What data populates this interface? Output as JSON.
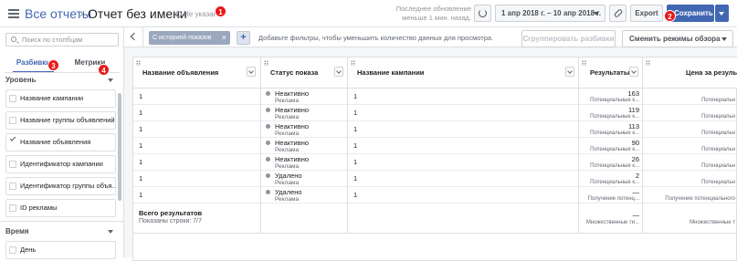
{
  "header": {
    "breadcrumb_root": "Все отчеты",
    "breadcrumb_sep": "›",
    "report_title": "Отчет без имени",
    "unnamed_label": "Не указан",
    "last_update": "Последнее обновление меньше 1 мин. назад.",
    "date_range": "1 апр 2018 г. – 10 апр 2018 г.",
    "export_label": "Export",
    "save_label": "Сохранить"
  },
  "badges": [
    "1",
    "2",
    "3",
    "4"
  ],
  "sidebar": {
    "search_placeholder": "Поиск по столбцам",
    "tabs": [
      "Разбивки",
      "Метрики"
    ],
    "section_level": "Уровень",
    "level_items": [
      {
        "label": "Название кампании",
        "checked": false
      },
      {
        "label": "Название группы объявлений",
        "checked": false
      },
      {
        "label": "Название объявления",
        "checked": true
      },
      {
        "label": "Идентификатор кампании",
        "checked": false
      },
      {
        "label": "Идентификатор группы объя...",
        "checked": false
      },
      {
        "label": "ID рекламы",
        "checked": false
      }
    ],
    "section_time": "Время",
    "time_items": [
      {
        "label": "День",
        "checked": false
      }
    ]
  },
  "filterbar": {
    "history_pill": "С историей показов",
    "add_label": "+",
    "hint": "Добавьте фильтры, чтобы уменьшить количество данных для просмотра.",
    "group_label": "Сгруппировать разбивки",
    "mode_label": "Сменить режимы обзора"
  },
  "table": {
    "columns": [
      "Название объявления",
      "Статус показа",
      "Название кампании",
      "Результаты",
      "Цена за резуль"
    ],
    "rows": [
      {
        "ad": "1",
        "status": "Неактивно",
        "status_sub": "Реклама",
        "campaign": "1",
        "results": "163",
        "results_sub": "Потенциальные к...",
        "cost_sub": "Потенциальн"
      },
      {
        "ad": "1",
        "status": "Неактивно",
        "status_sub": "Реклама",
        "campaign": "1",
        "results": "119",
        "results_sub": "Потенциальные к...",
        "cost_sub": "Потенциальн"
      },
      {
        "ad": "1",
        "status": "Неактивно",
        "status_sub": "Реклама",
        "campaign": "1",
        "results": "113",
        "results_sub": "Потенциальные к...",
        "cost_sub": "Потенциальн"
      },
      {
        "ad": "1",
        "status": "Неактивно",
        "status_sub": "Реклама",
        "campaign": "1",
        "results": "90",
        "results_sub": "Потенциальные к...",
        "cost_sub": "Потенциальн"
      },
      {
        "ad": "1",
        "status": "Неактивно",
        "status_sub": "Реклама",
        "campaign": "1",
        "results": "26",
        "results_sub": "Потенциальные к...",
        "cost_sub": "Потенциальн"
      },
      {
        "ad": "1",
        "status": "Удалено",
        "status_sub": "Реклама",
        "campaign": "1",
        "results": "2",
        "results_sub": "Потенциальные к...",
        "cost_sub": "Потенциальн"
      },
      {
        "ad": "1",
        "status": "Удалено",
        "status_sub": "Реклама",
        "campaign": "1",
        "results": "—",
        "results_sub": "Получение потенц...",
        "cost_sub": "Получение потенциального"
      }
    ],
    "total_title": "Всего результатов",
    "total_shown": "Показаны строки: 7/7",
    "total_results": "—",
    "total_results_sub": "Множественные ти...",
    "total_cost_sub": "Множественные т"
  },
  "colors": {
    "accent": "#4267b2",
    "badge": "#e9181a"
  }
}
